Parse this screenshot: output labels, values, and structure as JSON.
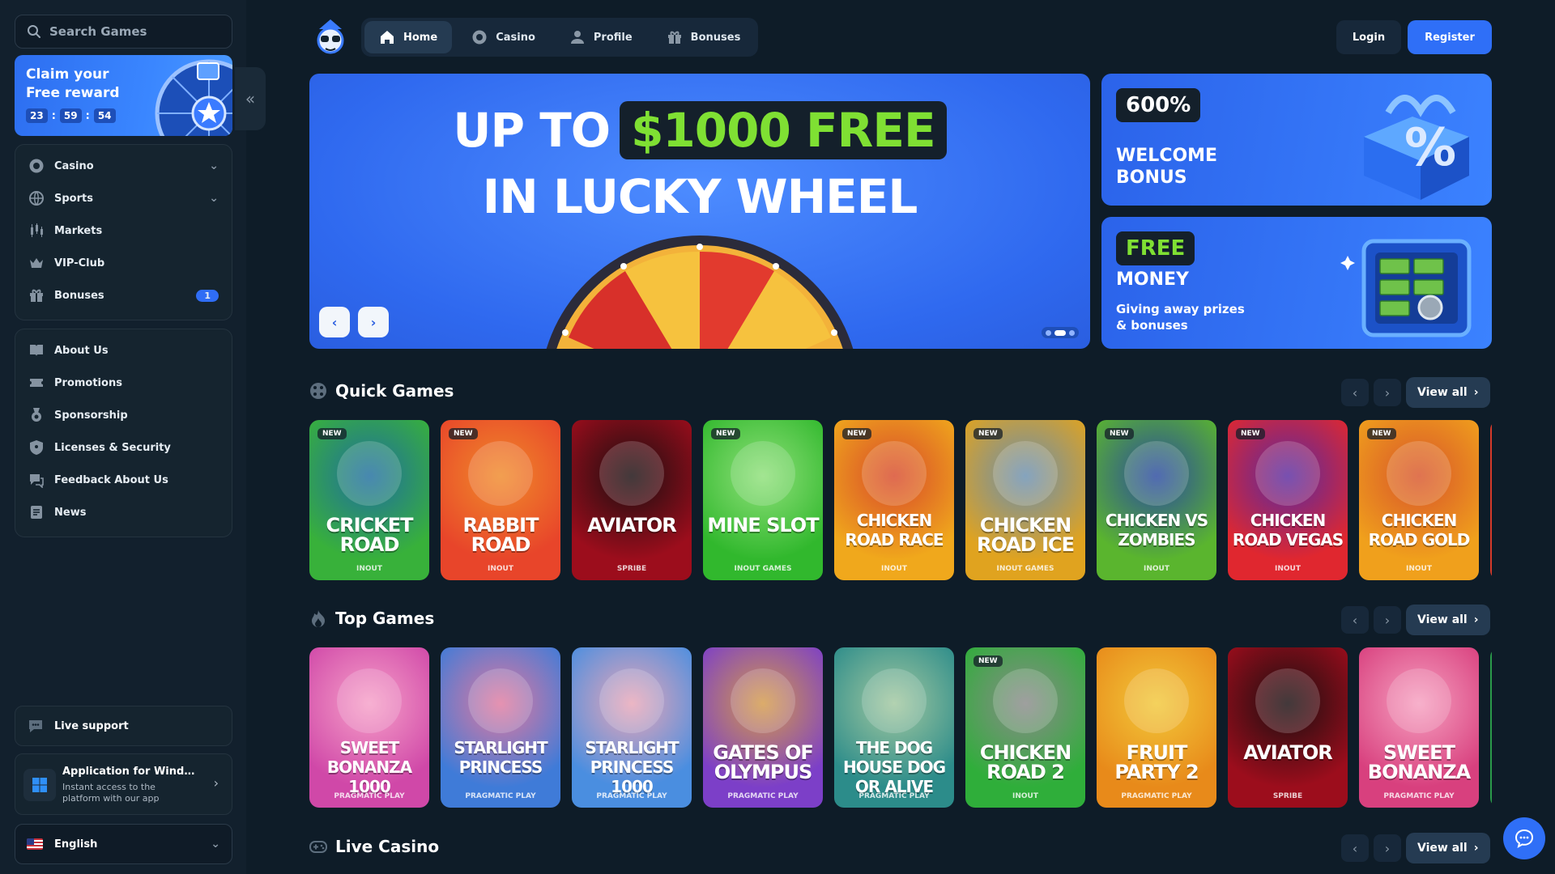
{
  "search": {
    "placeholder": "Search Games"
  },
  "claim": {
    "title": "Claim your Free reward",
    "timer": [
      "23",
      "59",
      "54"
    ]
  },
  "nav_main": [
    {
      "label": "Casino",
      "icon": "casino-chip-icon",
      "chevron": true
    },
    {
      "label": "Sports",
      "icon": "globe-ball-icon",
      "chevron": true
    },
    {
      "label": "Markets",
      "icon": "candlestick-icon"
    },
    {
      "label": "VIP-Club",
      "icon": "crown-icon"
    },
    {
      "label": "Bonuses",
      "icon": "gift-icon",
      "badge": "1"
    }
  ],
  "nav_info": [
    {
      "label": "About Us",
      "icon": "book-icon"
    },
    {
      "label": "Promotions",
      "icon": "ticket-icon"
    },
    {
      "label": "Sponsorship",
      "icon": "medal-icon"
    },
    {
      "label": "Licenses & Security",
      "icon": "shield-icon"
    },
    {
      "label": "Feedback About Us",
      "icon": "feedback-icon"
    },
    {
      "label": "News",
      "icon": "newspaper-icon"
    }
  ],
  "live_support": {
    "label": "Live support"
  },
  "app_promo": {
    "title": "Application for Windows",
    "description": "Instant access to the platform with our app"
  },
  "language": {
    "label": "English"
  },
  "topnav": {
    "tabs": [
      {
        "label": "Home",
        "icon": "home-icon",
        "active": true
      },
      {
        "label": "Casino",
        "icon": "casino-chip-icon"
      },
      {
        "label": "Profile",
        "icon": "user-icon"
      },
      {
        "label": "Bonuses",
        "icon": "gift-icon"
      }
    ],
    "login": "Login",
    "register": "Register"
  },
  "hero": {
    "line1_pre": "UP TO",
    "line1_highlight": "$1000 FREE",
    "line2": "IN LUCKY WHEEL",
    "slides": 3,
    "active_slide": 2
  },
  "promo1": {
    "badge": "600%",
    "title": "WELCOME BONUS"
  },
  "promo2": {
    "badge": "FREE",
    "title": "MONEY",
    "subtitle": "Giving away prizes & bonuses"
  },
  "colors": {
    "accent": "#2f6ff7",
    "green": "#7fe033",
    "bg": "#0e1c28"
  },
  "sections": [
    {
      "title": "Quick Games",
      "icon": "dice-icon",
      "view_all": "View all",
      "games": [
        {
          "name": "CRICKET ROAD",
          "provider": "INOUT",
          "new": true,
          "c1": "#38b13a",
          "c2": "#1f6e9f"
        },
        {
          "name": "RABBIT ROAD",
          "provider": "INOUT",
          "new": true,
          "c1": "#e8452a",
          "c2": "#f08a2a"
        },
        {
          "name": "AVIATOR",
          "provider": "SPRIBE",
          "new": false,
          "c1": "#9c0d1c",
          "c2": "#1a0e10"
        },
        {
          "name": "MINE SLOT",
          "provider": "INOUT GAMES",
          "new": true,
          "c1": "#31b82d",
          "c2": "#8fe07a"
        },
        {
          "name": "CHICKEN ROAD RACE",
          "provider": "INOUT",
          "new": true,
          "c1": "#f0a81c",
          "c2": "#d84a2a"
        },
        {
          "name": "CHICKEN ROAD ICE",
          "provider": "INOUT GAMES",
          "new": true,
          "c1": "#e0a31f",
          "c2": "#6a8fb0"
        },
        {
          "name": "CHICKEN VS ZOMBIES",
          "provider": "INOUT",
          "new": true,
          "c1": "#5ab52e",
          "c2": "#2a4aa0"
        },
        {
          "name": "CHICKEN ROAD VEGAS",
          "provider": "INOUT",
          "new": true,
          "c1": "#e0272f",
          "c2": "#5a2aa0"
        },
        {
          "name": "CHICKEN ROAD GOLD",
          "provider": "INOUT",
          "new": true,
          "c1": "#f0a01c",
          "c2": "#d8552a"
        }
      ]
    },
    {
      "title": "Top Games",
      "icon": "flame-icon",
      "view_all": "View all",
      "games": [
        {
          "name": "SWEET BONANZA 1000",
          "provider": "PRAGMATIC PLAY",
          "new": false,
          "c1": "#d048a8",
          "c2": "#f6a0c8"
        },
        {
          "name": "STARLIGHT PRINCESS",
          "provider": "PRAGMATIC PLAY",
          "new": false,
          "c1": "#3f7bd8",
          "c2": "#e07aa0"
        },
        {
          "name": "STARLIGHT PRINCESS 1000",
          "provider": "PRAGMATIC PLAY",
          "new": false,
          "c1": "#4a8ee0",
          "c2": "#e8a6b8"
        },
        {
          "name": "GATES OF OLYMPUS",
          "provider": "PRAGMATIC PLAY",
          "new": false,
          "c1": "#7c3fc8",
          "c2": "#d49a4a"
        },
        {
          "name": "THE DOG HOUSE DOG OR ALIVE",
          "provider": "PRAGMATIC PLAY",
          "new": false,
          "c1": "#2c8c8a",
          "c2": "#a2c8a0"
        },
        {
          "name": "CHICKEN ROAD 2",
          "provider": "INOUT",
          "new": true,
          "c1": "#2fae3a",
          "c2": "#8a8a8a"
        },
        {
          "name": "FRUIT PARTY 2",
          "provider": "PRAGMATIC PLAY",
          "new": false,
          "c1": "#e88a1a",
          "c2": "#f2c83a"
        },
        {
          "name": "AVIATOR",
          "provider": "SPRIBE",
          "new": false,
          "c1": "#9c0d1c",
          "c2": "#1a0e10"
        },
        {
          "name": "SWEET BONANZA",
          "provider": "PRAGMATIC PLAY",
          "new": false,
          "c1": "#d8407e",
          "c2": "#f6a0c0"
        }
      ]
    },
    {
      "title": "Live Casino",
      "icon": "gamepad-icon",
      "view_all": "View all",
      "games": []
    }
  ]
}
